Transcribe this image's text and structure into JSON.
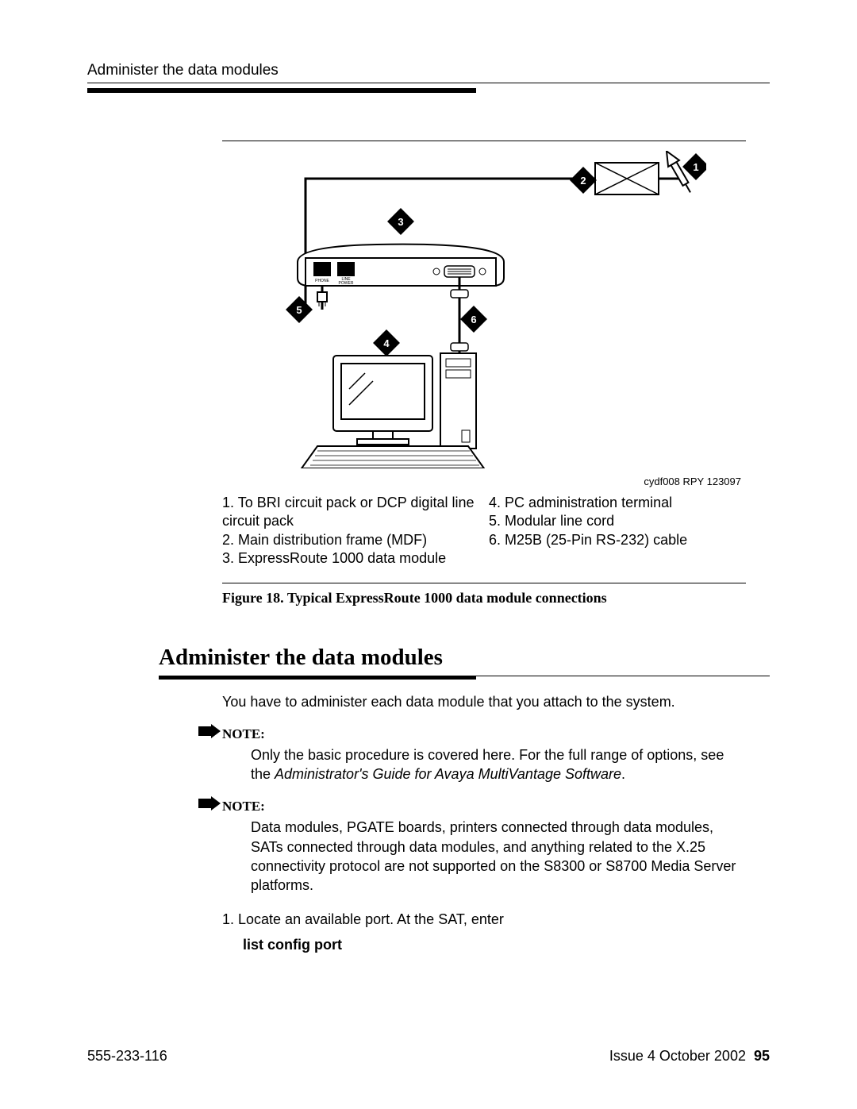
{
  "header": {
    "running_head": "Administer the data modules"
  },
  "figure": {
    "image_id": "cydf008 RPY 123097",
    "port_labels": {
      "phone": "PHONE",
      "line": "LINE",
      "power": "POWER"
    },
    "callouts": {
      "c1": "1",
      "c2": "2",
      "c3": "3",
      "c4": "4",
      "c5": "5",
      "c6": "6"
    },
    "legend_left": [
      "1. To BRI circuit pack or DCP digital line circuit pack",
      "2. Main distribution frame (MDF)",
      "3. ExpressRoute 1000 data module"
    ],
    "legend_right": [
      "4. PC administration terminal",
      "5. Modular line cord",
      "6. M25B (25-Pin RS-232) cable"
    ],
    "caption": "Figure 18.    Typical ExpressRoute 1000 data module connections"
  },
  "section": {
    "heading": "Administer the data modules",
    "intro": "You have to administer each data module that you attach to the system.",
    "note1_label": "NOTE:",
    "note1_body_a": "Only the basic procedure is covered here. For the full range of options, see the ",
    "note1_body_i": "Administrator's Guide for Avaya MultiVantage Software",
    "note1_body_b": ".",
    "note2_label": "NOTE:",
    "note2_body": "Data modules, PGATE boards, printers connected through data modules, SATs connected through data modules, and anything related to the X.25 connectivity protocol are not supported on the S8300 or S8700 Media Server platforms.",
    "step1": "1.  Locate an available port. At the SAT, enter",
    "step1_cmd": "list config port"
  },
  "footer": {
    "doc_number": "555-233-116",
    "issue": "Issue 4   October 2002",
    "page": "95"
  }
}
